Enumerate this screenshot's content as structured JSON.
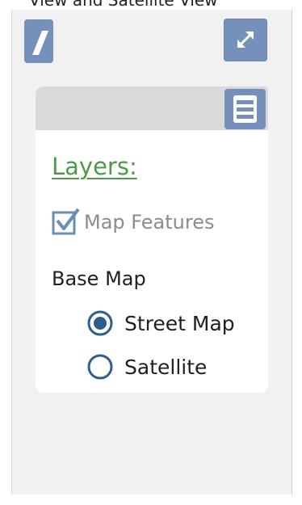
{
  "caption": {
    "text": "View and Satellite View"
  },
  "toolbar": {
    "left_tool_icon": "pencil-icon",
    "expand_icon": "expand-arrows-icon",
    "menu_icon": "hamburger-menu-icon"
  },
  "layers": {
    "title": "Layers:",
    "map_features": {
      "label": "Map Features",
      "checked": true
    },
    "base_map": {
      "label": "Base Map",
      "options": [
        {
          "label": "Street Map",
          "selected": true
        },
        {
          "label": "Satellite",
          "selected": false
        }
      ]
    }
  },
  "colors": {
    "button_blue": "#7590bb",
    "title_green": "#4d9a4b",
    "radio_blue": "#2f5d92",
    "panel_bg": "#f1f1f1",
    "header_bg": "#d9d9d9"
  }
}
